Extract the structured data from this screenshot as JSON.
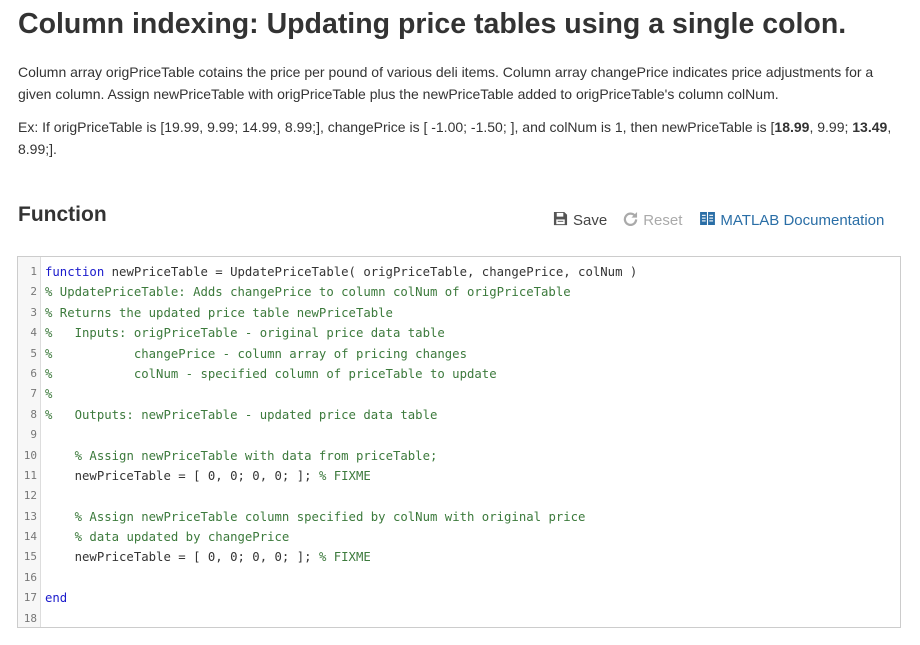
{
  "page": {
    "title": "Column indexing: Updating price tables using a single colon.",
    "description": "Column array origPriceTable cotains the price per pound of various deli items. Column array changePrice indicates price adjustments for a given column. Assign newPriceTable with origPriceTable plus the newPriceTable added to origPriceTable's column colNum.",
    "example": {
      "prefix": "Ex: If origPriceTable is [19.99, 9.99; 14.99, 8.99;], changePrice is [ -1.00; -1.50; ], and colNum is 1, then newPriceTable is [",
      "bold1": "18.99",
      "mid": ", 9.99; ",
      "bold2": "13.49",
      "suffix": ", 8.99;]."
    }
  },
  "function_section": {
    "heading": "Function",
    "toolbar": {
      "save_label": "Save",
      "reset_label": "Reset",
      "docs_label": "MATLAB Documentation"
    },
    "icons": {
      "save": "floppy-disk-icon",
      "reset": "reload-icon",
      "docs": "book-icon"
    },
    "colors": {
      "keyword": "#1a1acc",
      "comment": "#3c7a3c",
      "link": "#2a6ea6",
      "disabled": "#aaaaaa"
    },
    "code_lines": [
      {
        "n": "1",
        "segments": [
          {
            "t": "kw",
            "v": "function"
          },
          {
            "t": "tx",
            "v": " newPriceTable = UpdatePriceTable( origPriceTable, changePrice, colNum )"
          }
        ]
      },
      {
        "n": "2",
        "segments": [
          {
            "t": "cm",
            "v": "% UpdatePriceTable: Adds changePrice to column colNum of origPriceTable"
          }
        ]
      },
      {
        "n": "3",
        "segments": [
          {
            "t": "cm",
            "v": "% Returns the updated price table newPriceTable"
          }
        ]
      },
      {
        "n": "4",
        "segments": [
          {
            "t": "cm",
            "v": "%   Inputs: origPriceTable - original price data table"
          }
        ]
      },
      {
        "n": "5",
        "segments": [
          {
            "t": "cm",
            "v": "%           changePrice - column array of pricing changes"
          }
        ]
      },
      {
        "n": "6",
        "segments": [
          {
            "t": "cm",
            "v": "%           colNum - specified column of priceTable to update"
          }
        ]
      },
      {
        "n": "7",
        "segments": [
          {
            "t": "cm",
            "v": "%"
          }
        ]
      },
      {
        "n": "8",
        "segments": [
          {
            "t": "cm",
            "v": "%   Outputs: newPriceTable - updated price data table"
          }
        ]
      },
      {
        "n": "9",
        "segments": []
      },
      {
        "n": "10",
        "segments": [
          {
            "t": "tx",
            "v": "    "
          },
          {
            "t": "cm",
            "v": "% Assign newPriceTable with data from priceTable;"
          }
        ]
      },
      {
        "n": "11",
        "segments": [
          {
            "t": "tx",
            "v": "    newPriceTable = [ 0, 0; 0, 0; ]; "
          },
          {
            "t": "cm",
            "v": "% FIXME"
          }
        ]
      },
      {
        "n": "12",
        "segments": []
      },
      {
        "n": "13",
        "segments": [
          {
            "t": "tx",
            "v": "    "
          },
          {
            "t": "cm",
            "v": "% Assign newPriceTable column specified by colNum with original price"
          }
        ]
      },
      {
        "n": "14",
        "segments": [
          {
            "t": "tx",
            "v": "    "
          },
          {
            "t": "cm",
            "v": "% data updated by changePrice"
          }
        ]
      },
      {
        "n": "15",
        "segments": [
          {
            "t": "tx",
            "v": "    newPriceTable = [ 0, 0; 0, 0; ]; "
          },
          {
            "t": "cm",
            "v": "% FIXME"
          }
        ]
      },
      {
        "n": "16",
        "segments": []
      },
      {
        "n": "17",
        "segments": [
          {
            "t": "kw",
            "v": "end"
          }
        ]
      },
      {
        "n": "18",
        "segments": []
      }
    ]
  }
}
